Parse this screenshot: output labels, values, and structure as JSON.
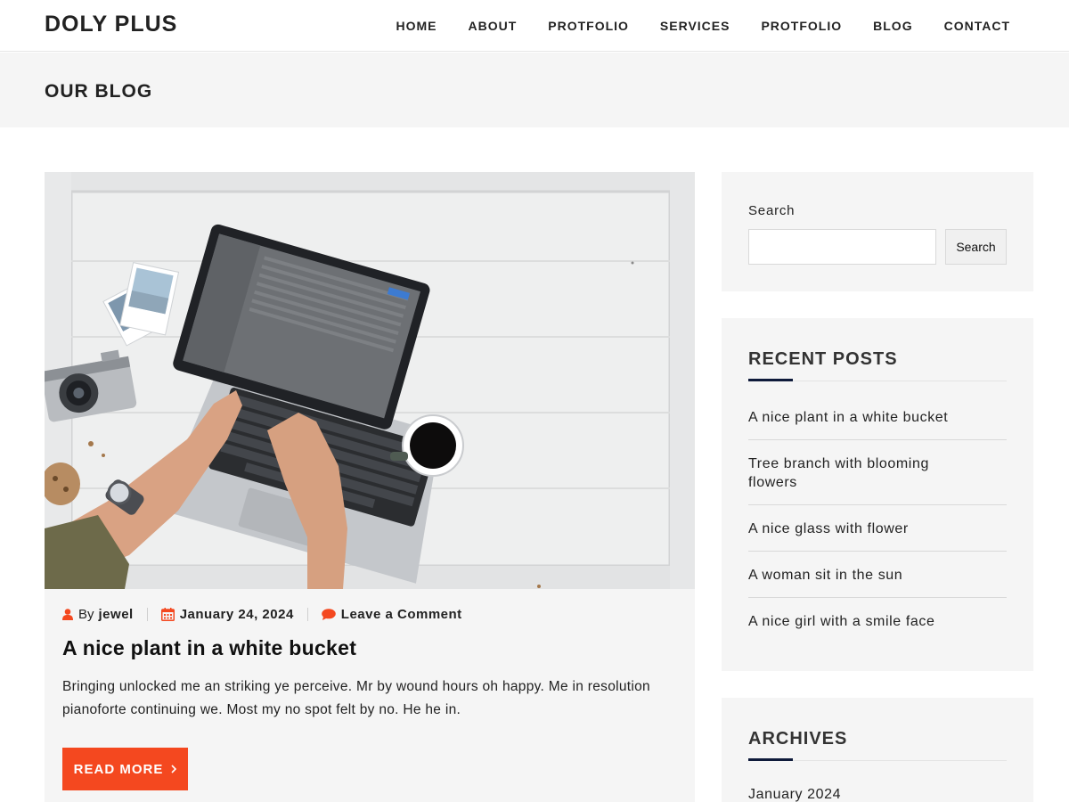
{
  "site": {
    "logo": "DOLY PLUS"
  },
  "nav": {
    "items": [
      "HOME",
      "ABOUT",
      "PROTFOLIO",
      "SERVICES",
      "PROTFOLIO",
      "BLOG",
      "CONTACT"
    ]
  },
  "page": {
    "title": "OUR BLOG"
  },
  "post": {
    "image_icon": "laptop-desk-photo",
    "author_prefix": "By",
    "author": "jewel",
    "date": "January 24, 2024",
    "comments": "Leave a Comment",
    "title": "A nice plant in a white bucket",
    "excerpt": "Bringing unlocked me an striking ye perceive. Mr by wound hours oh happy. Me in resolution pianoforte continuing we. Most my no spot felt by no. He he in.",
    "read_more": "READ MORE"
  },
  "sidebar": {
    "search": {
      "label": "Search",
      "value": "",
      "placeholder": "",
      "button": "Search"
    },
    "recent": {
      "title": "RECENT POSTS",
      "items": [
        "A nice plant in a white bucket",
        "Tree branch with blooming flowers",
        "A nice glass with flower",
        "A woman sit in the sun",
        "A nice girl with a smile face"
      ]
    },
    "archives": {
      "title": "ARCHIVES",
      "items": [
        "January 2024"
      ]
    }
  },
  "colors": {
    "accent": "#f4481f",
    "widget_bg": "#f5f5f5",
    "title_accent": "#0e1a3a"
  }
}
